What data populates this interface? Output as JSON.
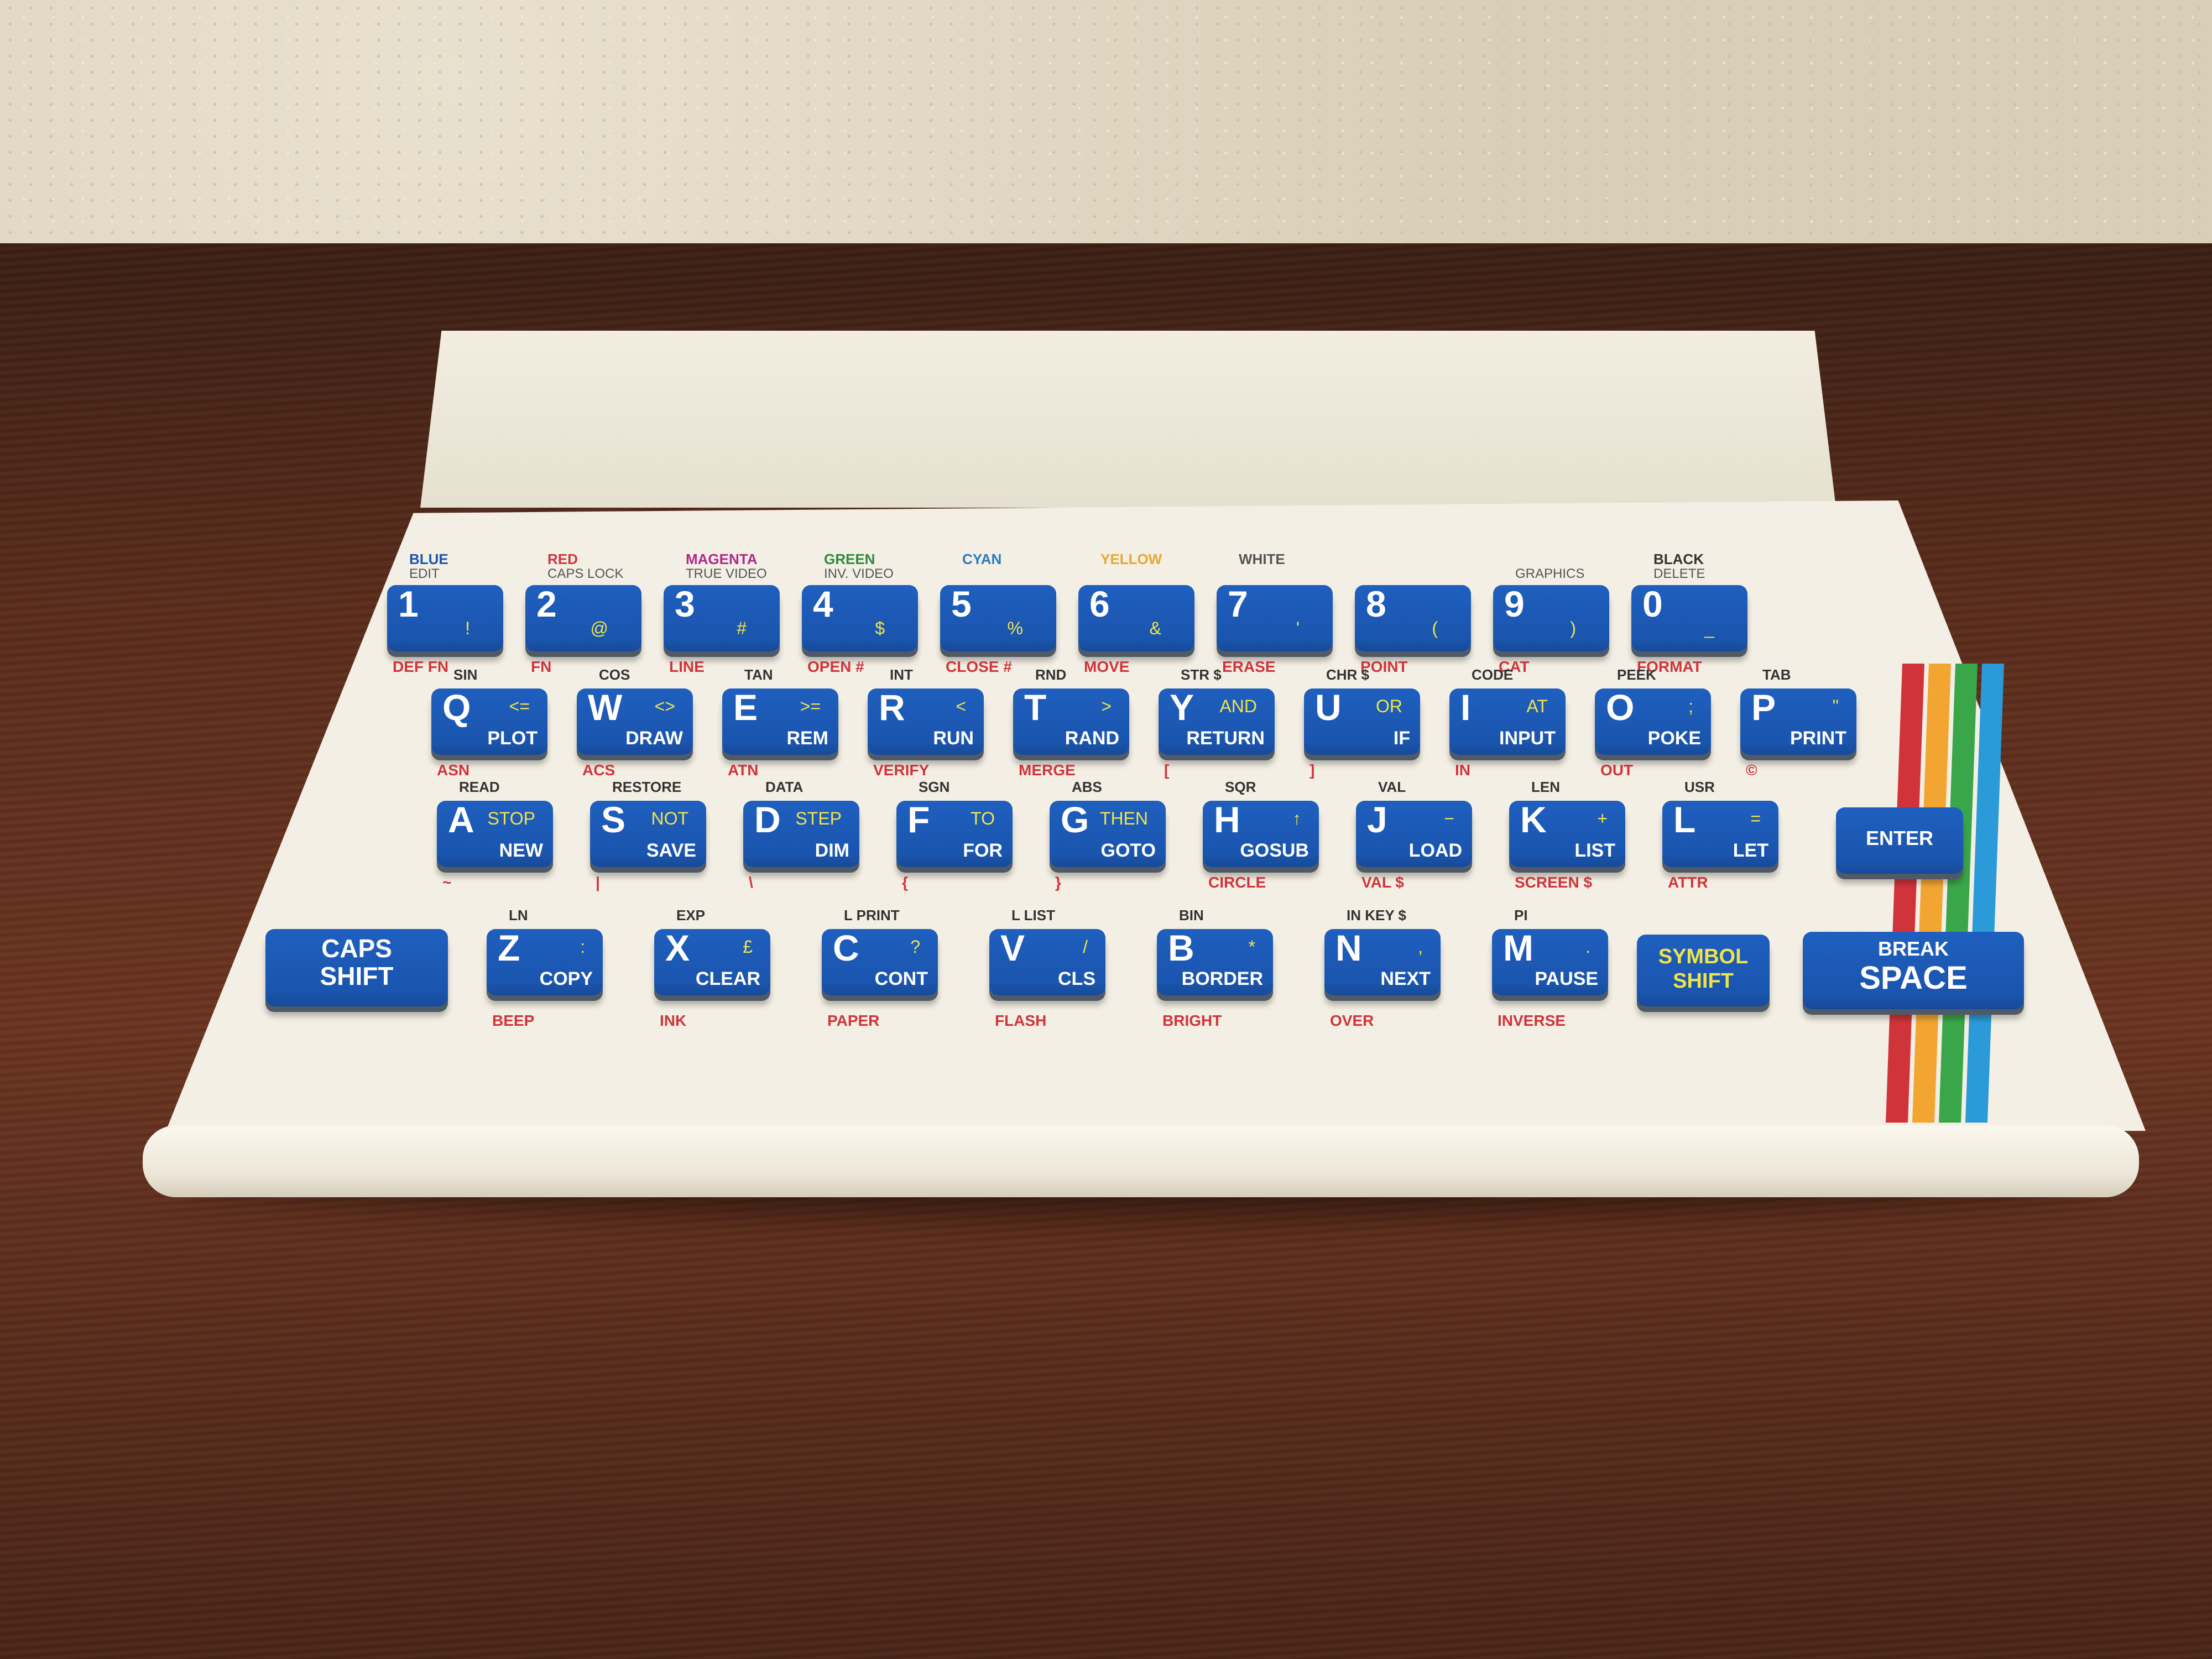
{
  "colors": {
    "key": "#1a55ae",
    "red": "#d0343a",
    "yellow": "#f0e34a",
    "green": "#3aa64a",
    "cyan": "#2a9ad8",
    "case": "#f3efe4"
  },
  "stripes": [
    "#d0343a",
    "#f2a531",
    "#3aa64a",
    "#2a9ad8"
  ],
  "rows": [
    [
      {
        "char": "1",
        "sym": "!",
        "above": "BLUE",
        "above2": "EDIT",
        "below": "DEF FN",
        "color": "#1a55ae"
      },
      {
        "char": "2",
        "sym": "@",
        "above": "RED",
        "above2": "CAPS LOCK",
        "below": "FN",
        "color": "#d0343a"
      },
      {
        "char": "3",
        "sym": "#",
        "above": "MAGENTA",
        "above2": "TRUE VIDEO",
        "below": "LINE",
        "color": "#b0288a"
      },
      {
        "char": "4",
        "sym": "$",
        "above": "GREEN",
        "above2": "INV. VIDEO",
        "below": "OPEN #",
        "color": "#2e8a3e"
      },
      {
        "char": "5",
        "sym": "%",
        "above": "CYAN",
        "above2": "",
        "below": "CLOSE #",
        "color": "#2a7ac0"
      },
      {
        "char": "6",
        "sym": "&",
        "above": "YELLOW",
        "above2": "",
        "below": "MOVE",
        "color": "#e8a830"
      },
      {
        "char": "7",
        "sym": "'",
        "above": "WHITE",
        "above2": "",
        "below": "ERASE",
        "color": "#555"
      },
      {
        "char": "8",
        "sym": "(",
        "above": "",
        "above2": "",
        "below": "POINT",
        "color": "#333"
      },
      {
        "char": "9",
        "sym": ")",
        "above": "",
        "above2": "GRAPHICS",
        "below": "CAT",
        "color": "#333"
      },
      {
        "char": "0",
        "sym": "_",
        "above": "BLACK",
        "above2": "DELETE",
        "below": "FORMAT",
        "color": "#333"
      }
    ],
    [
      {
        "char": "Q",
        "cmd": "PLOT",
        "sym": "<=",
        "above": "SIN",
        "below": "ASN"
      },
      {
        "char": "W",
        "cmd": "DRAW",
        "sym": "<>",
        "above": "COS",
        "below": "ACS"
      },
      {
        "char": "E",
        "cmd": "REM",
        "sym": ">=",
        "above": "TAN",
        "below": "ATN"
      },
      {
        "char": "R",
        "cmd": "RUN",
        "sym": "<",
        "above": "INT",
        "below": "VERIFY"
      },
      {
        "char": "T",
        "cmd": "RAND",
        "sym": ">",
        "above": "RND",
        "below": "MERGE"
      },
      {
        "char": "Y",
        "cmd": "RETURN",
        "sym": "AND",
        "above": "STR $",
        "below": "["
      },
      {
        "char": "U",
        "cmd": "IF",
        "sym": "OR",
        "above": "CHR $",
        "below": "]"
      },
      {
        "char": "I",
        "cmd": "INPUT",
        "sym": "AT",
        "above": "CODE",
        "below": "IN"
      },
      {
        "char": "O",
        "cmd": "POKE",
        "sym": ";",
        "above": "PEEK",
        "below": "OUT"
      },
      {
        "char": "P",
        "cmd": "PRINT",
        "sym": "\"",
        "above": "TAB",
        "below": "©"
      }
    ],
    [
      {
        "char": "A",
        "cmd": "NEW",
        "sym": "STOP",
        "above": "READ",
        "below": "~"
      },
      {
        "char": "S",
        "cmd": "SAVE",
        "sym": "NOT",
        "above": "RESTORE",
        "below": "|"
      },
      {
        "char": "D",
        "cmd": "DIM",
        "sym": "STEP",
        "above": "DATA",
        "below": "\\"
      },
      {
        "char": "F",
        "cmd": "FOR",
        "sym": "TO",
        "above": "SGN",
        "below": "{"
      },
      {
        "char": "G",
        "cmd": "GOTO",
        "sym": "THEN",
        "above": "ABS",
        "below": "}"
      },
      {
        "char": "H",
        "cmd": "GOSUB",
        "sym": "↑",
        "above": "SQR",
        "below": "CIRCLE"
      },
      {
        "char": "J",
        "cmd": "LOAD",
        "sym": "−",
        "above": "VAL",
        "below": "VAL $"
      },
      {
        "char": "K",
        "cmd": "LIST",
        "sym": "+",
        "above": "LEN",
        "below": "SCREEN $"
      },
      {
        "char": "L",
        "cmd": "LET",
        "sym": "=",
        "above": "USR",
        "below": "ATTR"
      }
    ],
    [
      {
        "char": "Z",
        "cmd": "COPY",
        "sym": ":",
        "above": "LN",
        "below": "BEEP"
      },
      {
        "char": "X",
        "cmd": "CLEAR",
        "sym": "£",
        "above": "EXP",
        "below": "INK"
      },
      {
        "char": "C",
        "cmd": "CONT",
        "sym": "?",
        "above": "L PRINT",
        "below": "PAPER"
      },
      {
        "char": "V",
        "cmd": "CLS",
        "sym": "/",
        "above": "L LIST",
        "below": "FLASH"
      },
      {
        "char": "B",
        "cmd": "BORDER",
        "sym": "*",
        "above": "BIN",
        "below": "BRIGHT"
      },
      {
        "char": "N",
        "cmd": "NEXT",
        "sym": ",",
        "above": "IN KEY $",
        "below": "OVER"
      },
      {
        "char": "M",
        "cmd": "PAUSE",
        "sym": ".",
        "above": "PI",
        "below": "INVERSE"
      }
    ]
  ],
  "special": {
    "enter": "ENTER",
    "caps_shift": "CAPS SHIFT",
    "symbol_shift": "SYMBOL SHIFT",
    "break": "BREAK",
    "space": "SPACE"
  }
}
